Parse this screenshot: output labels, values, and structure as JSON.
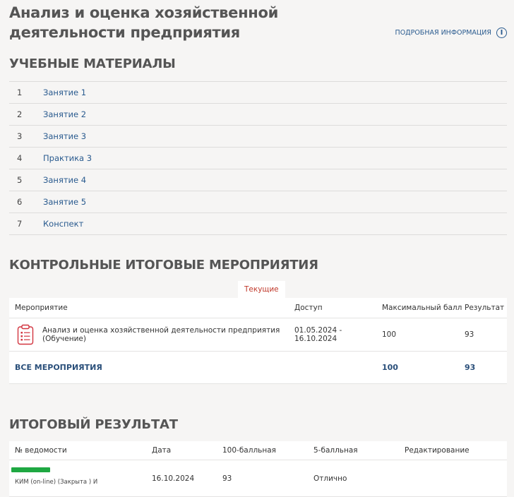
{
  "page": {
    "title": "Анализ и оценка хозяйственной деятельности предприятия",
    "more_info": "ПОДРОБНАЯ ИНФОРМАЦИЯ",
    "info_glyph": "i"
  },
  "materials": {
    "title": "УЧЕБНЫЕ МАТЕРИАЛЫ",
    "items": [
      {
        "num": "1",
        "label": "Занятие 1"
      },
      {
        "num": "2",
        "label": "Занятие 2"
      },
      {
        "num": "3",
        "label": "Занятие 3"
      },
      {
        "num": "4",
        "label": "Практика 3"
      },
      {
        "num": "5",
        "label": "Занятие 4"
      },
      {
        "num": "6",
        "label": "Занятие 5"
      },
      {
        "num": "7",
        "label": "Конспект"
      }
    ]
  },
  "events": {
    "title": "КОНТРОЛЬНЫЕ ИТОГОВЫЕ МЕРОПРИЯТИЯ",
    "tab_current": "Текущие",
    "headers": {
      "event": "Мероприятие",
      "access": "Доступ",
      "max": "Максимальный балл",
      "result": "Результат"
    },
    "rows": [
      {
        "name": "Анализ и оценка хозяйственной деятельности предприятия (Обучение)",
        "access": "01.05.2024 - 16.10.2024",
        "max": "100",
        "result": "93",
        "icon": "clipboard-icon"
      }
    ],
    "total": {
      "label": "ВСЕ МЕРОПРИЯТИЯ",
      "max": "100",
      "result": "93"
    }
  },
  "final": {
    "title": "ИТОГОВЫЙ РЕЗУЛЬТАТ",
    "headers": {
      "sheet": "№ ведомости",
      "date": "Дата",
      "score100": "100-балльная",
      "score5": "5-балльная",
      "edit": "Редактирование"
    },
    "rows": [
      {
        "sheet_note": "КИМ (on-line) (Закрыта ) И",
        "date": "16.10.2024",
        "score100": "93",
        "score5": "Отлично",
        "edit": ""
      }
    ]
  },
  "colors": {
    "link": "#2a5b8f",
    "accent_red": "#c0392b",
    "bar_green": "#1fa842"
  }
}
